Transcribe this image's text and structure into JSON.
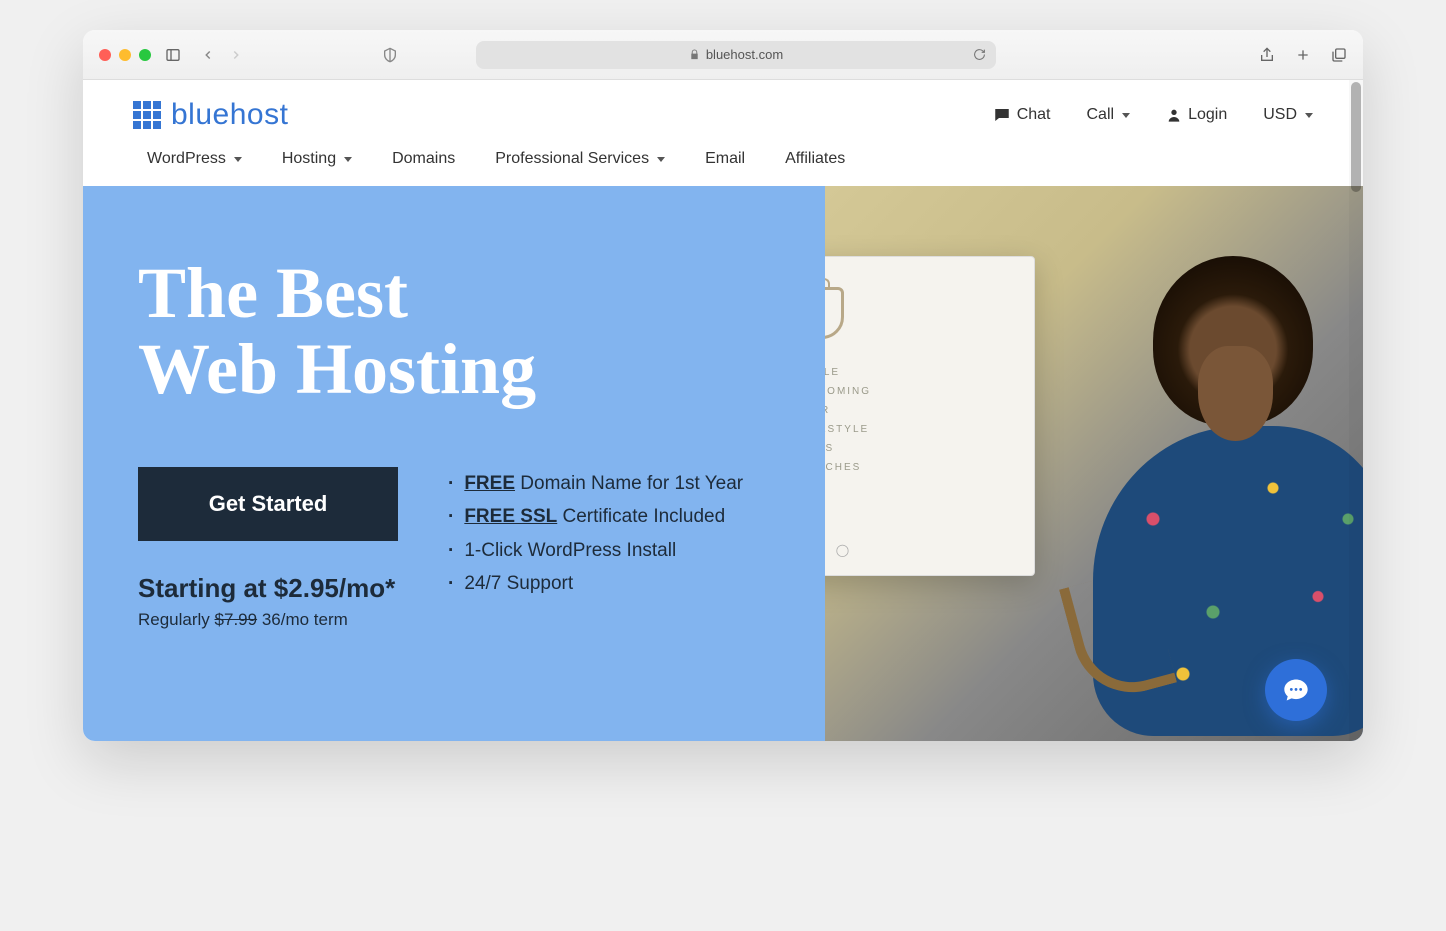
{
  "browser": {
    "url_host": "bluehost.com"
  },
  "header": {
    "logo_text": "bluehost",
    "chat": "Chat",
    "call": "Call",
    "login": "Login",
    "currency": "USD"
  },
  "nav": {
    "items": [
      {
        "label": "WordPress",
        "dropdown": true
      },
      {
        "label": "Hosting",
        "dropdown": true
      },
      {
        "label": "Domains",
        "dropdown": false
      },
      {
        "label": "Professional Services",
        "dropdown": true
      },
      {
        "label": "Email",
        "dropdown": false
      },
      {
        "label": "Affiliates",
        "dropdown": false
      }
    ]
  },
  "hero": {
    "title_line1": "The Best",
    "title_line2": "Web Hosting",
    "cta": "Get Started",
    "features": [
      {
        "bold": "FREE",
        "rest": " Domain Name for 1st Year",
        "underline": true
      },
      {
        "bold": "FREE SSL",
        "rest": " Certificate Included",
        "underline": true
      },
      {
        "bold": "",
        "rest": "1-Click WordPress Install",
        "underline": false
      },
      {
        "bold": "",
        "rest": "24/7 Support",
        "underline": false
      }
    ],
    "price_prefix": "Starting at ",
    "price": "$2.95/mo*",
    "regular_prefix": "Regularly ",
    "regular_price": "$7.99",
    "term": "  36/mo term"
  },
  "mock_site": {
    "menu": [
      "STYLE",
      "GROOMING",
      "HAIR",
      "LIFESTYLE",
      "CARS",
      "WATCHES"
    ]
  }
}
